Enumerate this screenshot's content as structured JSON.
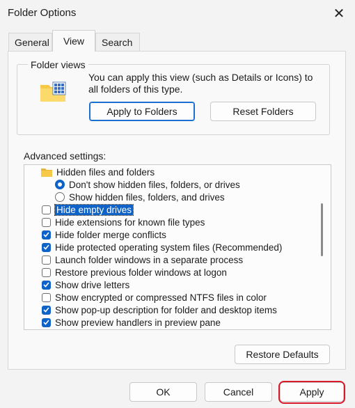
{
  "window": {
    "title": "Folder Options",
    "close_glyph": "✕"
  },
  "tabs": [
    {
      "label": "General"
    },
    {
      "label": "View"
    },
    {
      "label": "Search"
    }
  ],
  "folder_views": {
    "group_title": "Folder views",
    "description": "You can apply this view (such as Details or Icons) to all folders of this type.",
    "apply_button": "Apply to Folders",
    "reset_button": "Reset Folders"
  },
  "advanced": {
    "label": "Advanced settings:",
    "items": [
      {
        "type": "folder",
        "label": "Hidden files and folders"
      },
      {
        "type": "radio",
        "checked": true,
        "label": "Don't show hidden files, folders, or drives"
      },
      {
        "type": "radio",
        "checked": false,
        "label": "Show hidden files, folders, and drives"
      },
      {
        "type": "checkbox",
        "checked": false,
        "selected": true,
        "label": "Hide empty drives"
      },
      {
        "type": "checkbox",
        "checked": false,
        "label": "Hide extensions for known file types"
      },
      {
        "type": "checkbox",
        "checked": true,
        "label": "Hide folder merge conflicts"
      },
      {
        "type": "checkbox",
        "checked": true,
        "label": "Hide protected operating system files (Recommended)"
      },
      {
        "type": "checkbox",
        "checked": false,
        "label": "Launch folder windows in a separate process"
      },
      {
        "type": "checkbox",
        "checked": false,
        "label": "Restore previous folder windows at logon"
      },
      {
        "type": "checkbox",
        "checked": true,
        "label": "Show drive letters"
      },
      {
        "type": "checkbox",
        "checked": false,
        "label": "Show encrypted or compressed NTFS files in color"
      },
      {
        "type": "checkbox",
        "checked": true,
        "label": "Show pop-up description for folder and desktop items"
      },
      {
        "type": "checkbox",
        "checked": true,
        "label": "Show preview handlers in preview pane"
      }
    ]
  },
  "restore_defaults": "Restore Defaults",
  "footer": {
    "ok": "OK",
    "cancel": "Cancel",
    "apply": "Apply"
  },
  "colors": {
    "accent": "#0f63c6",
    "highlight_ring": "#d7192a"
  }
}
